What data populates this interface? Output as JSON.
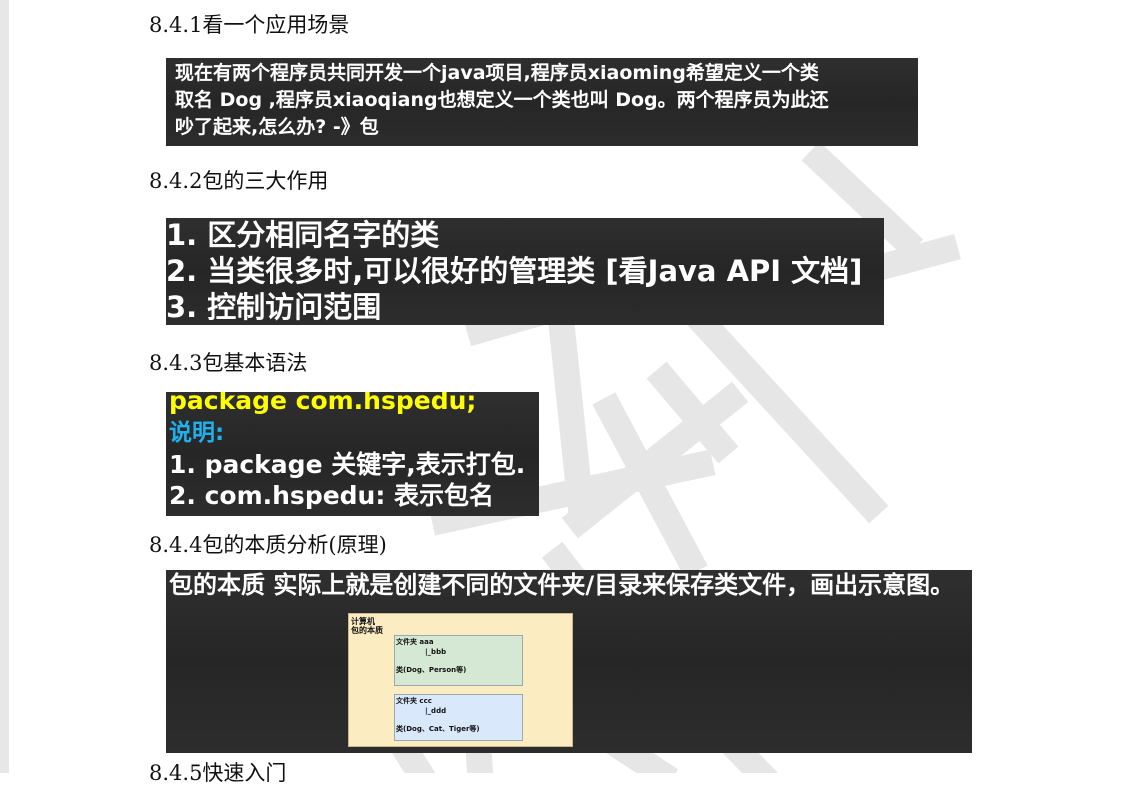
{
  "sections": [
    {
      "heading": "8.4.1看一个应用场景"
    },
    {
      "heading": "8.4.2包的三大作用"
    },
    {
      "heading": "8.4.3包基本语法"
    },
    {
      "heading": "8.4.4包的本质分析(原理)"
    },
    {
      "heading": "8.4.5快速入门"
    }
  ],
  "scenario": {
    "lines": [
      "现在有两个程序员共同开发一个java项目,程序员xiaoming希望定义一个类",
      "取名 Dog ,程序员xiaoqiang也想定义一个类也叫 Dog。两个程序员为此还",
      "吵了起来,怎么办? -》包"
    ]
  },
  "functions": {
    "items": [
      "1.  区分相同名字的类",
      "2.  当类很多时,可以很好的管理类 [看Java API 文档]",
      "3.  控制访问范围"
    ]
  },
  "syntax": {
    "code": "package com.hspedu;",
    "note_label": "说明:",
    "items": [
      "1.  package 关键字,表示打包.",
      "2.  com.hspedu: 表示包名"
    ]
  },
  "essence": {
    "title": "包的本质 实际上就是创建不同的文件夹/目录来保存类文件，画出示意图。",
    "diagram": {
      "label_line1": "计算机",
      "label_line2": "包的本质",
      "folder1": {
        "name": "文件夹 aaa",
        "sub": "|_bbb",
        "classes": "类(Dog、Person等)"
      },
      "folder2": {
        "name": "文件夹 ccc",
        "sub": "|_ddd",
        "classes": "类(Dog、Cat、Tiger等)"
      }
    }
  },
  "colors": {
    "board": "#2b2b2b",
    "code_yellow": "#ffff00",
    "note_blue": "#1fb1ee",
    "diagram_bg": "#fbecc2",
    "folder_green": "#d5e8d4",
    "folder_blue": "#dae8fc",
    "watermark": "#e5e5e5"
  },
  "icons": {
    "watermark": "watermark-logo-icon"
  }
}
